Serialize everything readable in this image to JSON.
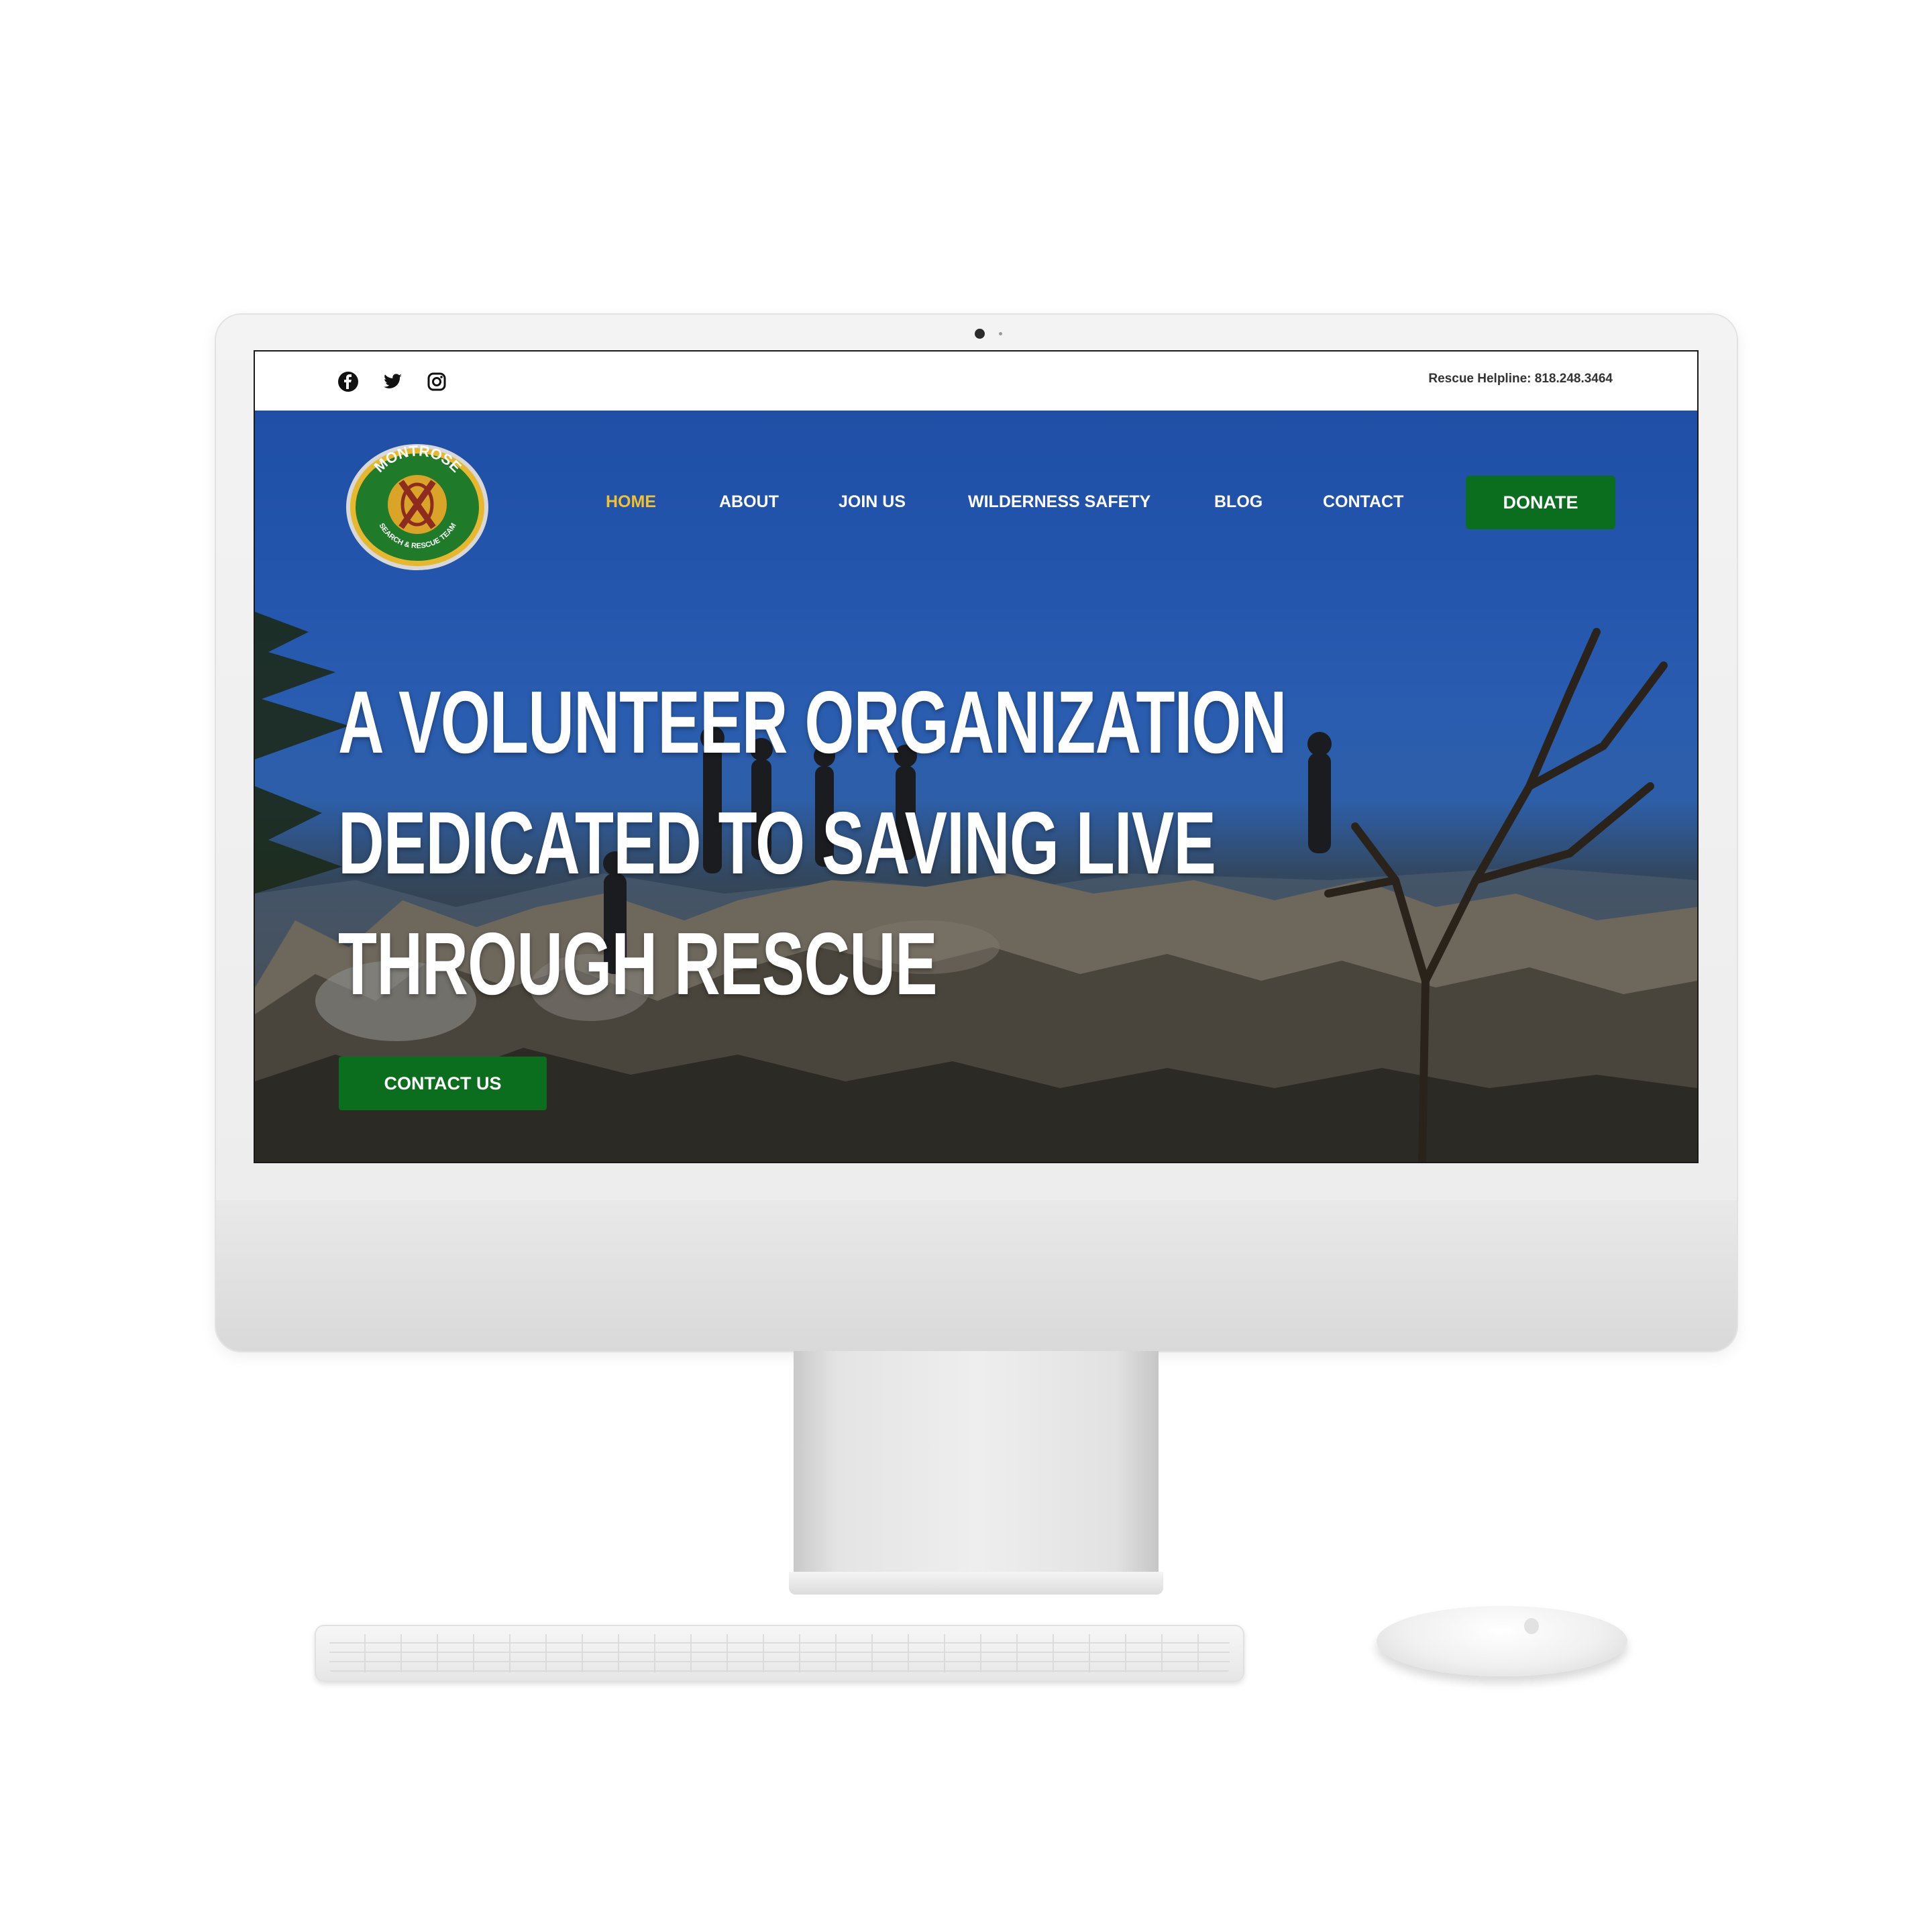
{
  "site": {
    "helpline": "Rescue Helpline: 818.248.3464",
    "social_icons": [
      "facebook-icon",
      "twitter-icon",
      "instagram-icon"
    ],
    "logo": {
      "top_text": "MONTROSE",
      "bottom_text": "SEARCH & RESCUE TEAM",
      "alt_color": "#1f7a2a"
    },
    "nav": {
      "items": [
        {
          "label": "HOME",
          "active": true
        },
        {
          "label": "ABOUT"
        },
        {
          "label": "JOIN US"
        },
        {
          "label": "WILDERNESS SAFETY"
        },
        {
          "label": "BLOG"
        },
        {
          "label": "CONTACT"
        }
      ],
      "donate_label": "DONATE"
    },
    "hero": {
      "headline_lines": [
        "A VOLUNTEER ORGANIZATION",
        "DEDICATED TO SAVING LIVE",
        "THROUGH RESCUE"
      ],
      "cta_label": "CONTACT US"
    }
  },
  "colors": {
    "accent_green": "#0b6e1e",
    "active_nav": "#f2c12e",
    "sky_blue": "#2456ae"
  }
}
